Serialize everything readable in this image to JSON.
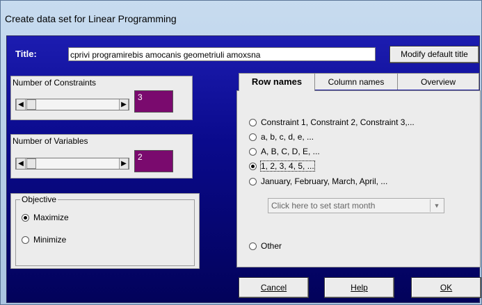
{
  "window": {
    "title": "Create data set for Linear Programming"
  },
  "title_row": {
    "label": "Title:",
    "value": "cprivi programirebis amocanis geometriuli amoxsna",
    "modify_button": "Modify default title"
  },
  "constraints": {
    "label": "Number of Constraints",
    "value": "3"
  },
  "variables": {
    "label": "Number of Variables",
    "value": "2"
  },
  "objective": {
    "legend": "Objective",
    "options": [
      {
        "label": "Maximize",
        "selected": true
      },
      {
        "label": "Minimize",
        "selected": false
      }
    ]
  },
  "tabs": [
    {
      "label": "Row names",
      "active": true
    },
    {
      "label": "Column names",
      "active": false
    },
    {
      "label": "Overview",
      "active": false
    }
  ],
  "row_names": {
    "options": [
      {
        "label": "Constraint 1, Constraint 2, Constraint 3,...",
        "selected": false
      },
      {
        "label": "a, b, c, d, e, ...",
        "selected": false
      },
      {
        "label": "A, B, C, D, E, ...",
        "selected": false
      },
      {
        "label": "1, 2, 3, 4, 5, ...",
        "selected": true
      },
      {
        "label": "January, February, March, April, ...",
        "selected": false
      },
      {
        "label": "Other",
        "selected": false
      }
    ],
    "month_select_placeholder": "Click here to set start month"
  },
  "buttons": {
    "cancel": "Cancel",
    "help": "Help",
    "ok": "OK"
  },
  "colors": {
    "value_box": "#7a0a6e",
    "client_background": "#0a0a8c"
  }
}
